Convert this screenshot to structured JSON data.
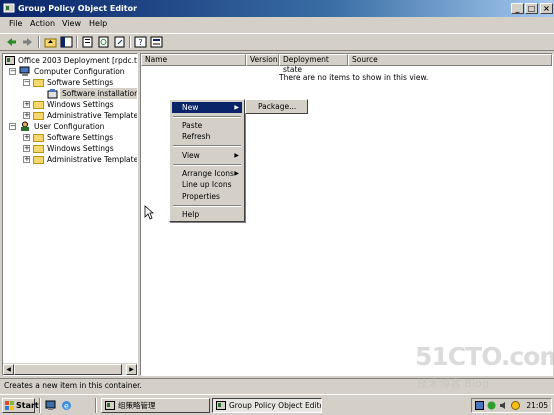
{
  "window": {
    "title": "Group Policy Object Editor"
  },
  "menubar": {
    "items": [
      "File",
      "Action",
      "View",
      "Help"
    ]
  },
  "tree": {
    "root": "Office 2003 Deployment [rpdc.test",
    "computer_config": "Computer Configuration",
    "cc_software_settings": "Software Settings",
    "cc_software_installation": "Software installation",
    "cc_windows_settings": "Windows Settings",
    "cc_admin_templates": "Administrative Templates",
    "user_config": "User Configuration",
    "uc_software_settings": "Software Settings",
    "uc_windows_settings": "Windows Settings",
    "uc_admin_templates": "Administrative Templates"
  },
  "list": {
    "columns": [
      "Name",
      "Version",
      "Deployment state",
      "Source"
    ],
    "empty_text": "There are no items to show in this view."
  },
  "context_menu": {
    "new": "New",
    "paste": "Paste",
    "refresh": "Refresh",
    "view": "View",
    "arrange_icons": "Arrange Icons",
    "line_up_icons": "Line up Icons",
    "properties": "Properties",
    "help": "Help"
  },
  "submenu": {
    "package": "Package..."
  },
  "status": {
    "text": "Creates a new item in this container."
  },
  "taskbar": {
    "start": "Start",
    "task1": "组策略管理",
    "task2": "Group Policy Object Editor",
    "clock": "21:05"
  },
  "watermark": {
    "line1": "51CTO.com",
    "line2": "技术博客  Blog"
  },
  "colors": {
    "title_active": "#0a246a",
    "face": "#d4d0c8",
    "highlight": "#0a246a",
    "desktop": "#3a6ea5"
  }
}
